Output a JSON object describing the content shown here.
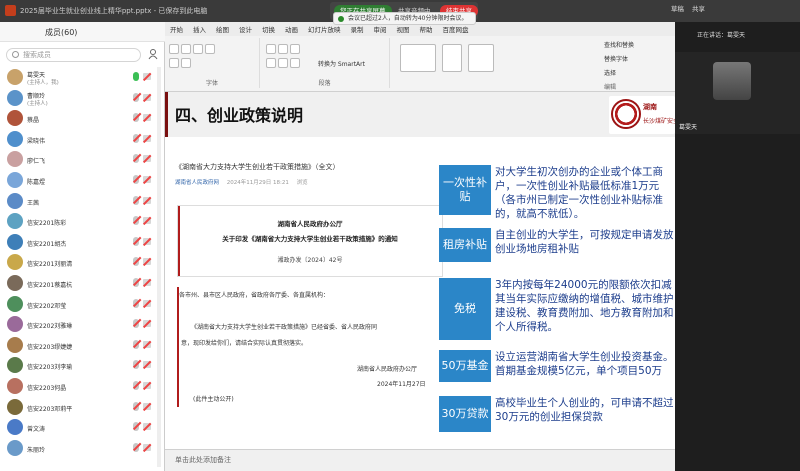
{
  "window": {
    "doc_title": "2025届毕业生就业创业线上精华ppt.pptx - 已保存到此电脑"
  },
  "share_bar": {
    "screen_label": "您正在共享屏幕",
    "audio_label": "共享音频中",
    "stop_label": "结束共享"
  },
  "notice": "会议已超过2人，自动转为40分钟限时会议。",
  "top_right": {
    "draft": "草稿",
    "share": "共享",
    "zoom": "放大 Tencent 会议"
  },
  "ribbon": {
    "tabs": [
      "开始",
      "插入",
      "绘图",
      "设计",
      "切换",
      "动画",
      "幻灯片放映",
      "录制",
      "审阅",
      "视图",
      "帮助",
      "百度网盘"
    ],
    "group_font": "字体",
    "group_para": "段落",
    "convert": "转换为 SmartArt",
    "right_items": [
      "查找和替换",
      "替换字体",
      "选择"
    ],
    "right_labels": [
      "编辑",
      "审阅"
    ]
  },
  "panel": {
    "title": "成员(60)",
    "search_placeholder": "搜索成员",
    "participants": [
      {
        "name": "葛雯天",
        "sub": "(主持人，我)",
        "avatar": "#c8a26a"
      },
      {
        "name": "曹顺玲",
        "sub": "(主持人)",
        "avatar": "#5b93c9"
      },
      {
        "name": "蔡晶",
        "sub": "",
        "avatar": "#b0543a"
      },
      {
        "name": "梁晓伟",
        "sub": "",
        "avatar": "#4f8fcc"
      },
      {
        "name": "廖仁飞",
        "sub": "",
        "avatar": "#c9a0a0"
      },
      {
        "name": "陈嘉煜",
        "sub": "",
        "avatar": "#7aa6d9"
      },
      {
        "name": "王茜",
        "sub": "",
        "avatar": "#5b8bc7"
      },
      {
        "name": "信安2201陈彩",
        "sub": "",
        "avatar": "#5da2c2"
      },
      {
        "name": "信安2201胡杰",
        "sub": "",
        "avatar": "#3e7fb8"
      },
      {
        "name": "信安2201刘丽清",
        "sub": "",
        "avatar": "#c9a84a"
      },
      {
        "name": "信安2201蔡嘉杭",
        "sub": "",
        "avatar": "#7a6a5a"
      },
      {
        "name": "信安2202邓莹",
        "sub": "",
        "avatar": "#4e8f5c"
      },
      {
        "name": "信安2202刘雅琳",
        "sub": "",
        "avatar": "#9a6a9a"
      },
      {
        "name": "信安2203缪婕婕",
        "sub": "",
        "avatar": "#a77c4c"
      },
      {
        "name": "信安2203刘李瑜",
        "sub": "",
        "avatar": "#5a7a4a"
      },
      {
        "name": "信安2203何晶",
        "sub": "",
        "avatar": "#b87060"
      },
      {
        "name": "信安2203邓莉平",
        "sub": "",
        "avatar": "#7a6a3a"
      },
      {
        "name": "曾文涛",
        "sub": "",
        "avatar": "#4a7ac7"
      },
      {
        "name": "朱丽玲",
        "sub": "",
        "avatar": "#6a9ac9"
      }
    ]
  },
  "notes_hint": "单击此处添加备注",
  "slide": {
    "title": "四、创业政策说明",
    "logo_line1": "湖南",
    "logo_line2": "长沙煤矿安全技术培训中心",
    "doc": {
      "headline": "《湖南省大力支持大学生创业若干政策措施》（全文）",
      "source": "湖南省人民政府网",
      "date": "2024年11月29日 18:21",
      "action": "浏览",
      "box_line1": "湖南省人民政府办公厅",
      "box_line2": "关于印发《湖南省大力支持大学生创业若干政策措施》的通知",
      "box_line3": "湘政办发〔2024〕42号",
      "para1": "各市州、县市区人民政府，省政府各厅委、各直属机构：",
      "para2": "《湖南省大力支持大学生创业若干政策措施》已经省委、省人民政府同",
      "para3": "意，现印发给你们，请结合实际认真贯彻落实。",
      "sign1": "湖南省人民政府办公厅",
      "sign2": "2024年11月27日",
      "public": "(此件主动公开)"
    },
    "policies": [
      {
        "label": "一次性补贴",
        "text": "对大学生初次创办的企业或个体工商户，一次性创业补贴最低标准1万元（各市州已制定一次性创业补贴标准的，就高不就低）。"
      },
      {
        "label": "租房补贴",
        "text": "自主创业的大学生，可按规定申请发放创业场地房租补贴"
      },
      {
        "label": "免税",
        "text": "3年内按每年24000元的限额依次扣减其当年实际应缴纳的增值税、城市维护建设税、教育费附加、地方教育附加和个人所得税。"
      },
      {
        "label": "50万基金",
        "text": "设立运营湖南省大学生创业投资基金。首期基金规模5亿元，单个项目50万"
      },
      {
        "label": "30万贷款",
        "text": "高校毕业生个人创业的，可申请不超过30万元的创业担保贷款"
      }
    ]
  },
  "video": {
    "speaking": "正在讲话：葛雯天",
    "name": "葛雯天"
  }
}
